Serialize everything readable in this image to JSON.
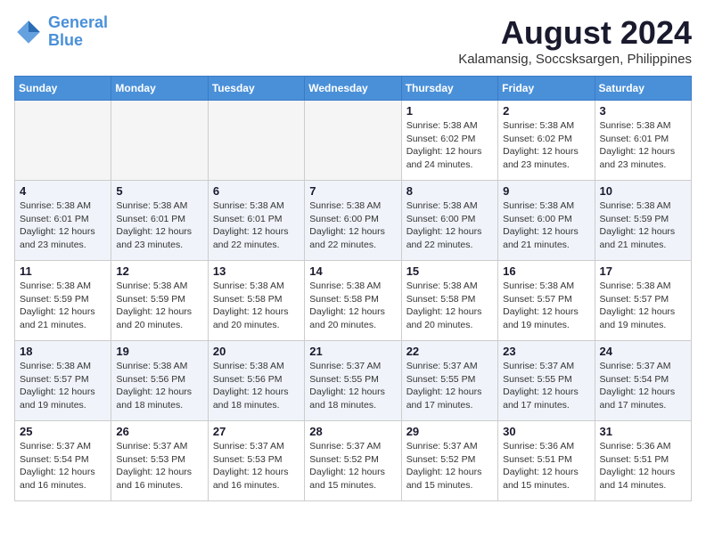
{
  "header": {
    "logo_line1": "General",
    "logo_line2": "Blue",
    "month_year": "August 2024",
    "location": "Kalamansig, Soccsksargen, Philippines"
  },
  "weekdays": [
    "Sunday",
    "Monday",
    "Tuesday",
    "Wednesday",
    "Thursday",
    "Friday",
    "Saturday"
  ],
  "weeks": [
    [
      {
        "day": "",
        "info": ""
      },
      {
        "day": "",
        "info": ""
      },
      {
        "day": "",
        "info": ""
      },
      {
        "day": "",
        "info": ""
      },
      {
        "day": "1",
        "info": "Sunrise: 5:38 AM\nSunset: 6:02 PM\nDaylight: 12 hours\nand 24 minutes."
      },
      {
        "day": "2",
        "info": "Sunrise: 5:38 AM\nSunset: 6:02 PM\nDaylight: 12 hours\nand 23 minutes."
      },
      {
        "day": "3",
        "info": "Sunrise: 5:38 AM\nSunset: 6:01 PM\nDaylight: 12 hours\nand 23 minutes."
      }
    ],
    [
      {
        "day": "4",
        "info": "Sunrise: 5:38 AM\nSunset: 6:01 PM\nDaylight: 12 hours\nand 23 minutes."
      },
      {
        "day": "5",
        "info": "Sunrise: 5:38 AM\nSunset: 6:01 PM\nDaylight: 12 hours\nand 23 minutes."
      },
      {
        "day": "6",
        "info": "Sunrise: 5:38 AM\nSunset: 6:01 PM\nDaylight: 12 hours\nand 22 minutes."
      },
      {
        "day": "7",
        "info": "Sunrise: 5:38 AM\nSunset: 6:00 PM\nDaylight: 12 hours\nand 22 minutes."
      },
      {
        "day": "8",
        "info": "Sunrise: 5:38 AM\nSunset: 6:00 PM\nDaylight: 12 hours\nand 22 minutes."
      },
      {
        "day": "9",
        "info": "Sunrise: 5:38 AM\nSunset: 6:00 PM\nDaylight: 12 hours\nand 21 minutes."
      },
      {
        "day": "10",
        "info": "Sunrise: 5:38 AM\nSunset: 5:59 PM\nDaylight: 12 hours\nand 21 minutes."
      }
    ],
    [
      {
        "day": "11",
        "info": "Sunrise: 5:38 AM\nSunset: 5:59 PM\nDaylight: 12 hours\nand 21 minutes."
      },
      {
        "day": "12",
        "info": "Sunrise: 5:38 AM\nSunset: 5:59 PM\nDaylight: 12 hours\nand 20 minutes."
      },
      {
        "day": "13",
        "info": "Sunrise: 5:38 AM\nSunset: 5:58 PM\nDaylight: 12 hours\nand 20 minutes."
      },
      {
        "day": "14",
        "info": "Sunrise: 5:38 AM\nSunset: 5:58 PM\nDaylight: 12 hours\nand 20 minutes."
      },
      {
        "day": "15",
        "info": "Sunrise: 5:38 AM\nSunset: 5:58 PM\nDaylight: 12 hours\nand 20 minutes."
      },
      {
        "day": "16",
        "info": "Sunrise: 5:38 AM\nSunset: 5:57 PM\nDaylight: 12 hours\nand 19 minutes."
      },
      {
        "day": "17",
        "info": "Sunrise: 5:38 AM\nSunset: 5:57 PM\nDaylight: 12 hours\nand 19 minutes."
      }
    ],
    [
      {
        "day": "18",
        "info": "Sunrise: 5:38 AM\nSunset: 5:57 PM\nDaylight: 12 hours\nand 19 minutes."
      },
      {
        "day": "19",
        "info": "Sunrise: 5:38 AM\nSunset: 5:56 PM\nDaylight: 12 hours\nand 18 minutes."
      },
      {
        "day": "20",
        "info": "Sunrise: 5:38 AM\nSunset: 5:56 PM\nDaylight: 12 hours\nand 18 minutes."
      },
      {
        "day": "21",
        "info": "Sunrise: 5:37 AM\nSunset: 5:55 PM\nDaylight: 12 hours\nand 18 minutes."
      },
      {
        "day": "22",
        "info": "Sunrise: 5:37 AM\nSunset: 5:55 PM\nDaylight: 12 hours\nand 17 minutes."
      },
      {
        "day": "23",
        "info": "Sunrise: 5:37 AM\nSunset: 5:55 PM\nDaylight: 12 hours\nand 17 minutes."
      },
      {
        "day": "24",
        "info": "Sunrise: 5:37 AM\nSunset: 5:54 PM\nDaylight: 12 hours\nand 17 minutes."
      }
    ],
    [
      {
        "day": "25",
        "info": "Sunrise: 5:37 AM\nSunset: 5:54 PM\nDaylight: 12 hours\nand 16 minutes."
      },
      {
        "day": "26",
        "info": "Sunrise: 5:37 AM\nSunset: 5:53 PM\nDaylight: 12 hours\nand 16 minutes."
      },
      {
        "day": "27",
        "info": "Sunrise: 5:37 AM\nSunset: 5:53 PM\nDaylight: 12 hours\nand 16 minutes."
      },
      {
        "day": "28",
        "info": "Sunrise: 5:37 AM\nSunset: 5:52 PM\nDaylight: 12 hours\nand 15 minutes."
      },
      {
        "day": "29",
        "info": "Sunrise: 5:37 AM\nSunset: 5:52 PM\nDaylight: 12 hours\nand 15 minutes."
      },
      {
        "day": "30",
        "info": "Sunrise: 5:36 AM\nSunset: 5:51 PM\nDaylight: 12 hours\nand 15 minutes."
      },
      {
        "day": "31",
        "info": "Sunrise: 5:36 AM\nSunset: 5:51 PM\nDaylight: 12 hours\nand 14 minutes."
      }
    ]
  ]
}
